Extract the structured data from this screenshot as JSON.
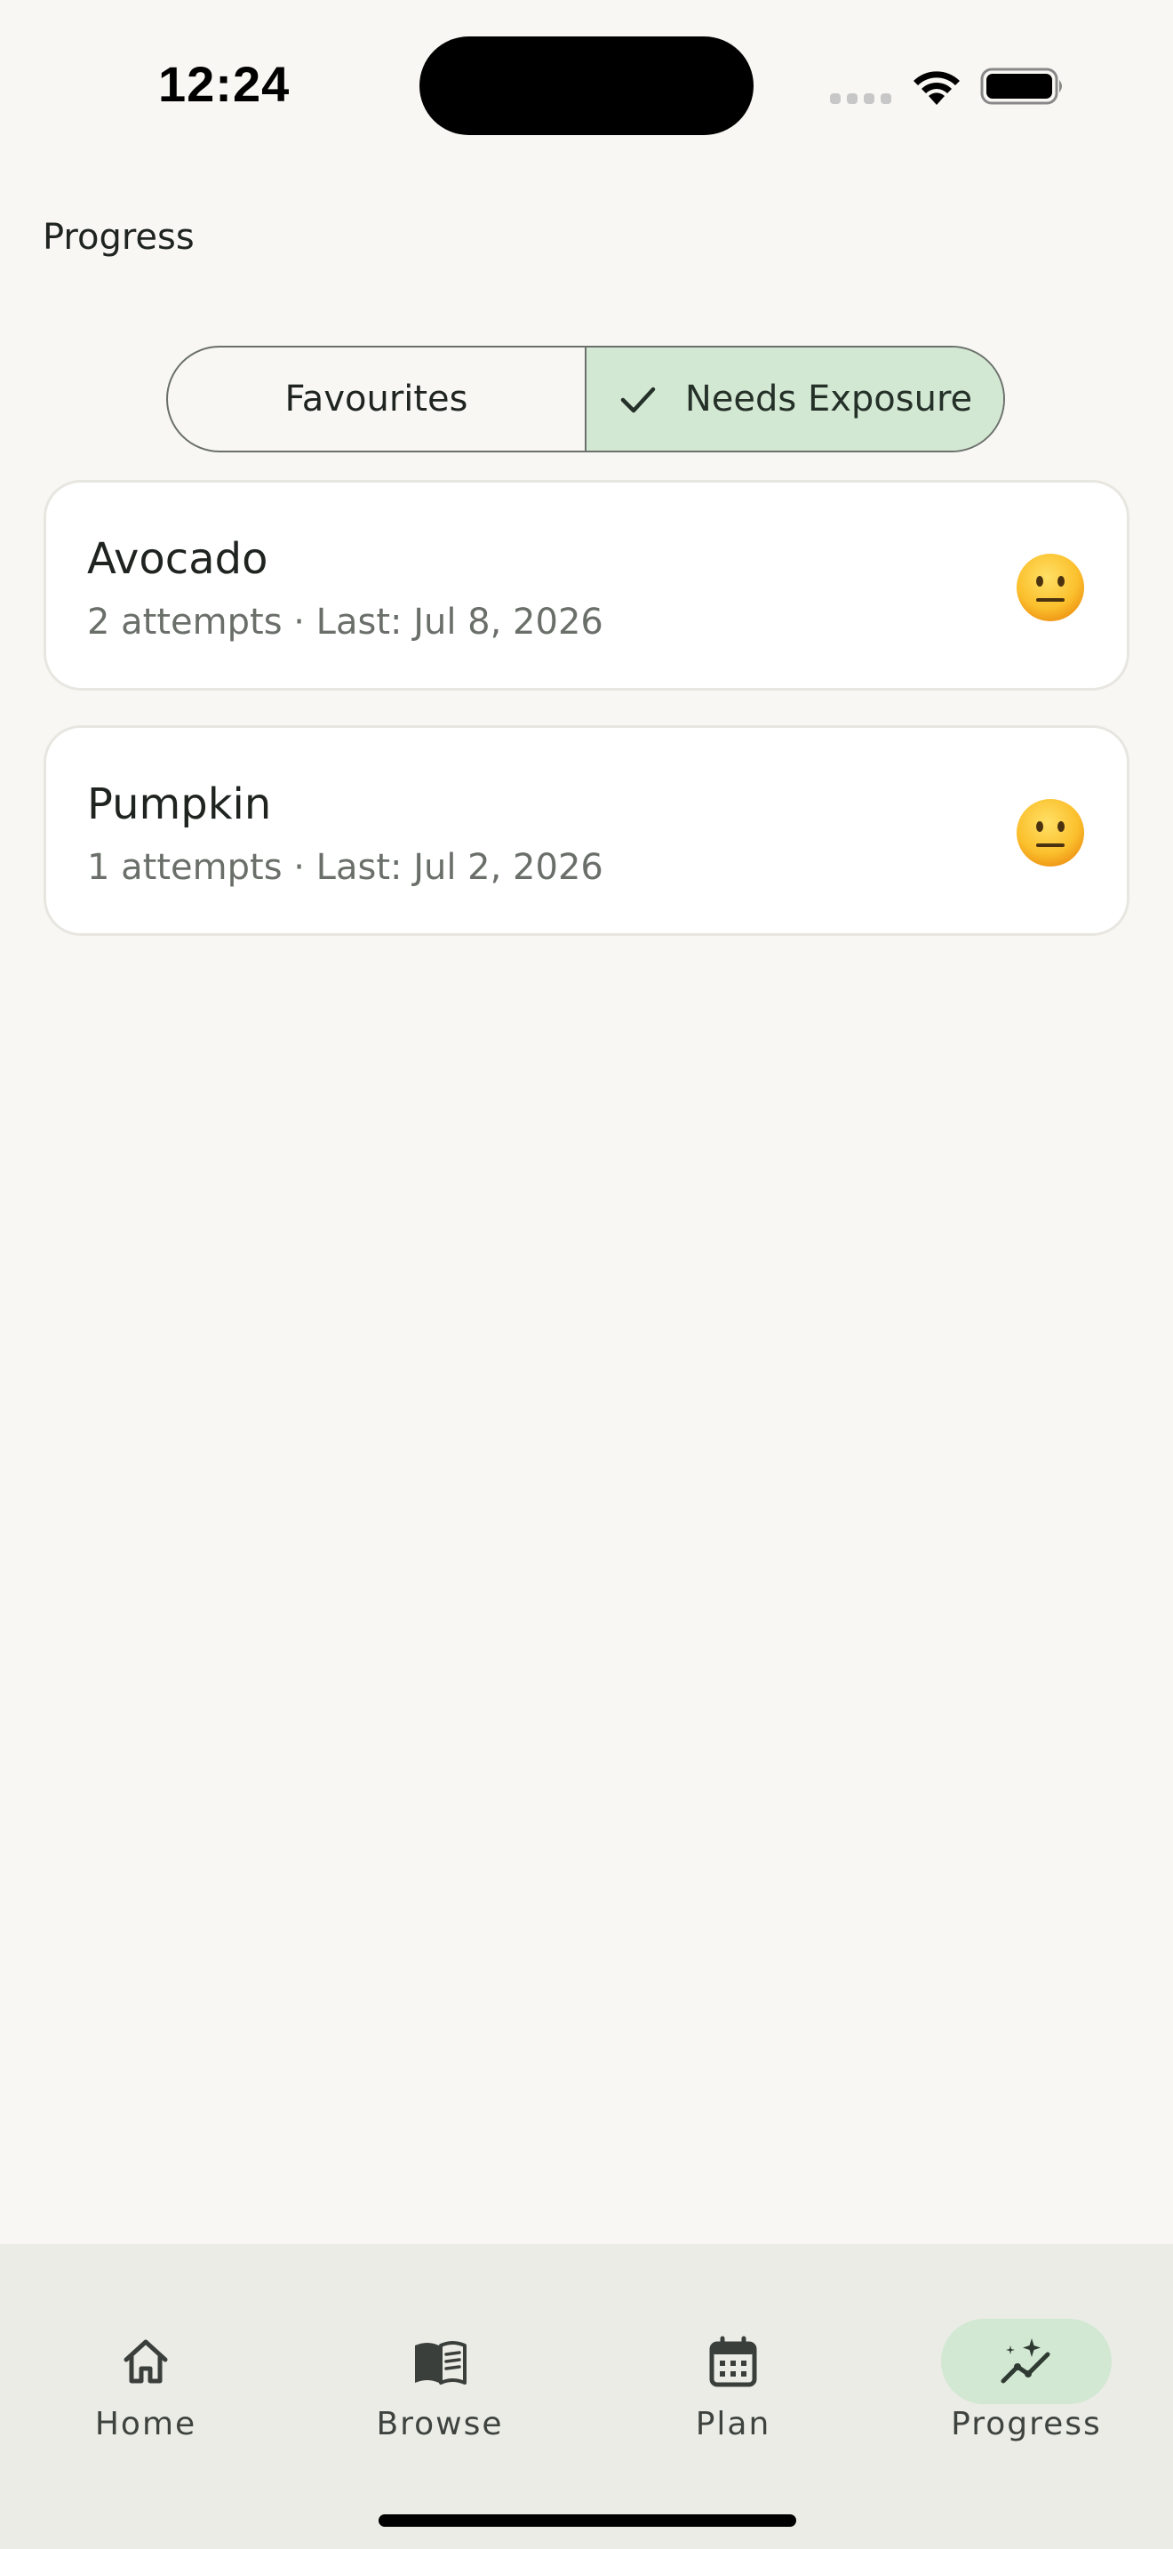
{
  "status_bar": {
    "time": "12:24"
  },
  "header": {
    "title": "Progress"
  },
  "filter": {
    "options": [
      {
        "label": "Favourites",
        "selected": false
      },
      {
        "label": "Needs Exposure",
        "selected": true
      }
    ]
  },
  "foods": [
    {
      "name": "Avocado",
      "detail": "2 attempts · Last: Jul 8, 2026",
      "reaction_icon": "neutral-face-icon"
    },
    {
      "name": "Pumpkin",
      "detail": "1 attempts · Last: Jul 2, 2026",
      "reaction_icon": "neutral-face-icon"
    }
  ],
  "nav": {
    "items": [
      {
        "label": "Home",
        "icon": "home-icon"
      },
      {
        "label": "Browse",
        "icon": "book-icon"
      },
      {
        "label": "Plan",
        "icon": "calendar-icon"
      },
      {
        "label": "Progress",
        "icon": "trend-sparkle-icon",
        "active": true
      }
    ]
  },
  "colors": {
    "background": "#f8f7f3",
    "accent": "#d2e8d3",
    "nav_background": "#ebece6"
  }
}
